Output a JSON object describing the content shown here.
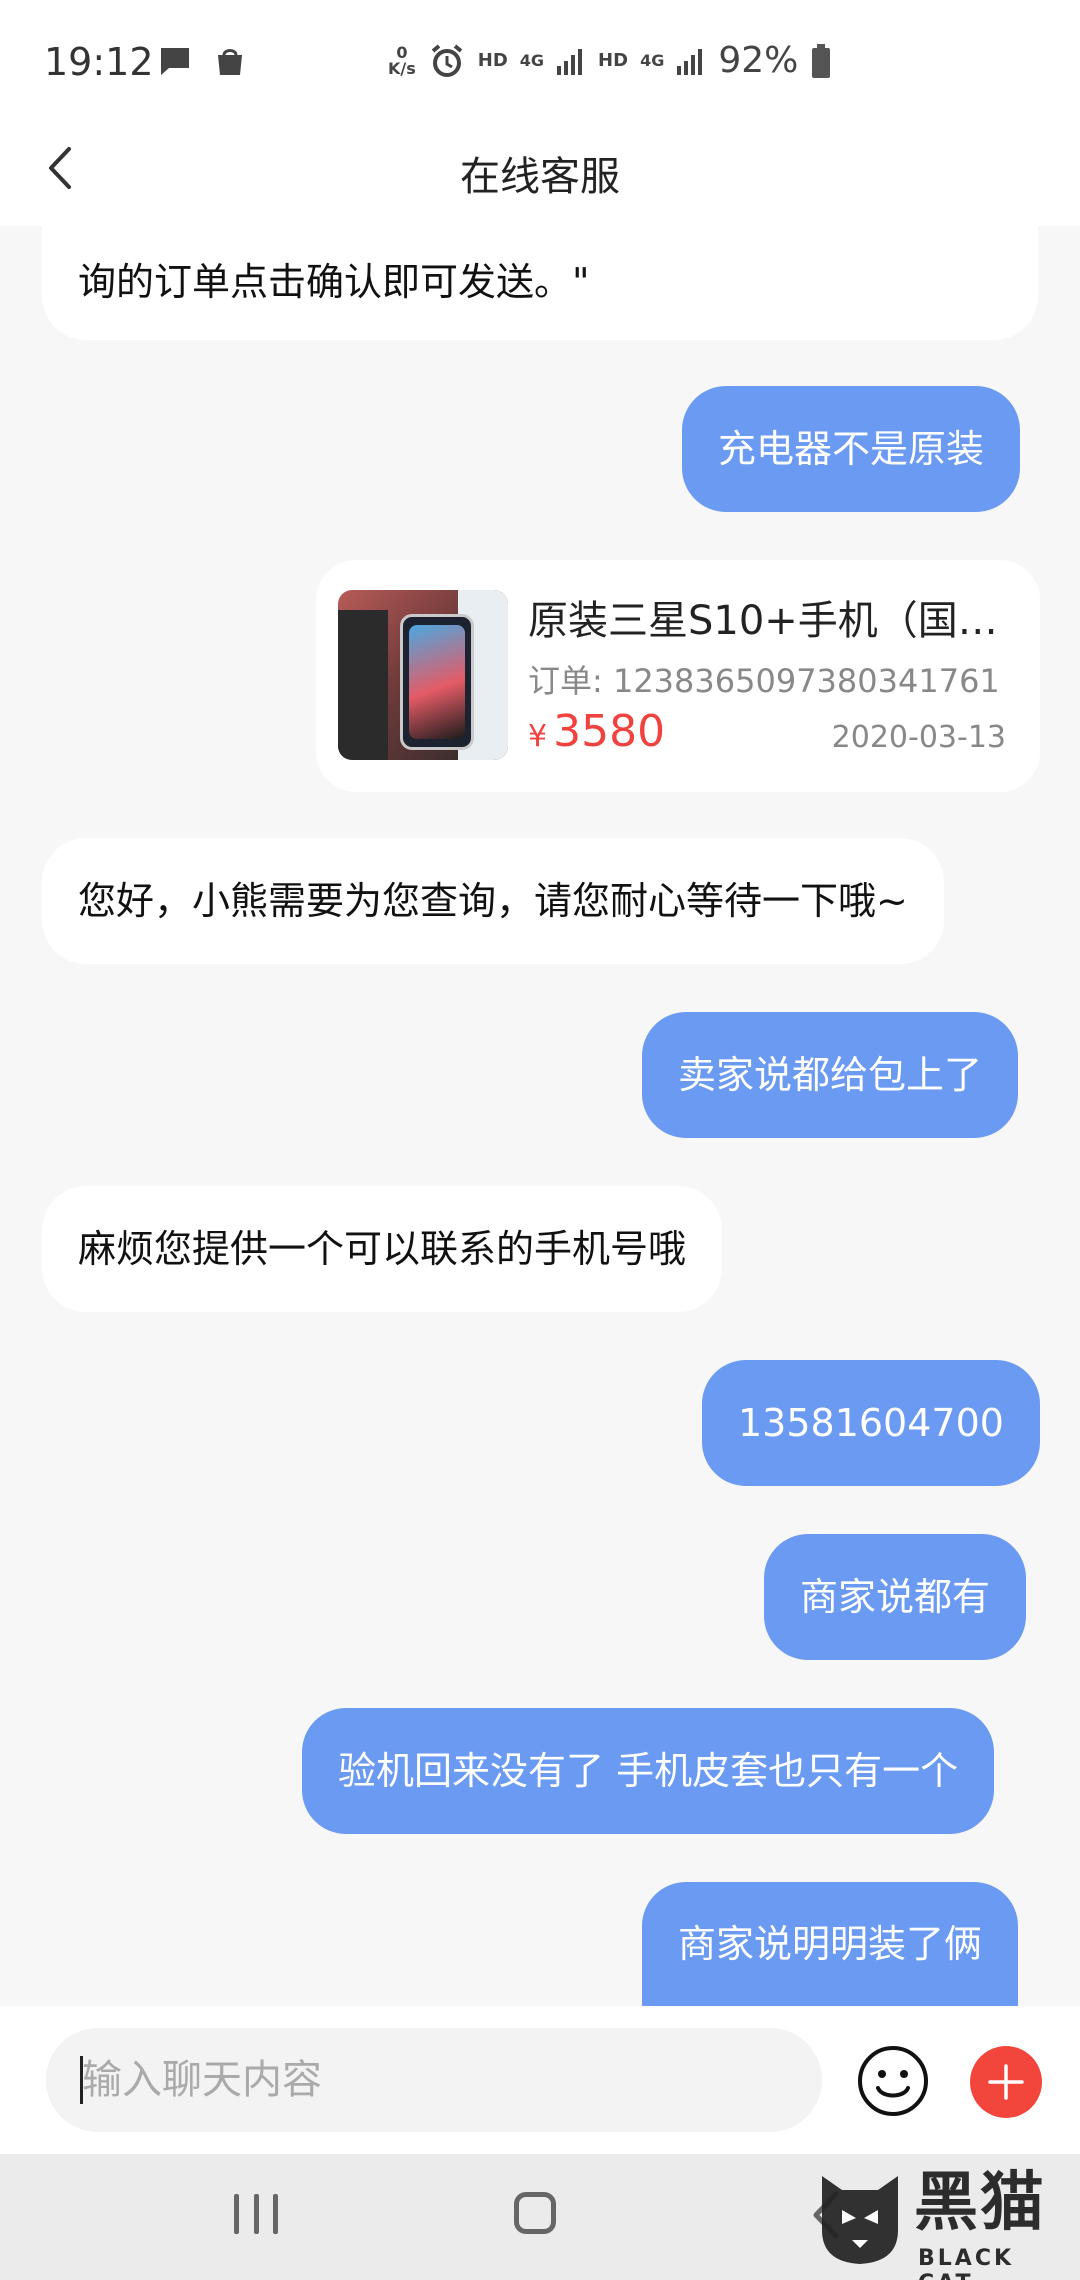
{
  "status_bar": {
    "time": "19:12",
    "net_speed_top": "0",
    "net_speed_bottom": "K/s",
    "hd1": "HD",
    "net1": "4G",
    "hd2": "HD",
    "net2": "4G",
    "battery": "92%",
    "icons": [
      "message-icon",
      "shopping-bag-icon",
      "alarm-icon",
      "signal-icon",
      "battery-icon"
    ]
  },
  "header": {
    "title": "在线客服",
    "back_icon": "chevron-left-icon"
  },
  "messages": [
    {
      "side": "left",
      "text": "询的订单点击确认即可发送。\""
    },
    {
      "side": "right",
      "text": "充电器不是原装"
    },
    {
      "side": "left",
      "text": "您好，小熊需要为您查询，请您耐心等待一下哦~"
    },
    {
      "side": "right",
      "text": "卖家说都给包上了"
    },
    {
      "side": "left",
      "text": "麻烦您提供一个可以联系的手机号哦"
    },
    {
      "side": "right",
      "text": "13581604700"
    },
    {
      "side": "right",
      "text": "商家说都有"
    },
    {
      "side": "right",
      "text": "验机回来没有了 手机皮套也只有一个"
    },
    {
      "side": "right",
      "text": "商家说明明装了俩"
    }
  ],
  "order_card": {
    "title": "原装三星S10+手机（国…",
    "order_no": "订单: 1238365097380341761",
    "currency": "¥",
    "price": "3580",
    "date": "2020-03-13"
  },
  "input": {
    "placeholder": "输入聊天内容",
    "value": ""
  },
  "colors": {
    "accent_bubble": "#6a9af1",
    "price_red": "#f0433f",
    "plus_red": "#f2463d"
  },
  "watermark": {
    "big": "黑猫",
    "small": "BLACK CAT"
  }
}
